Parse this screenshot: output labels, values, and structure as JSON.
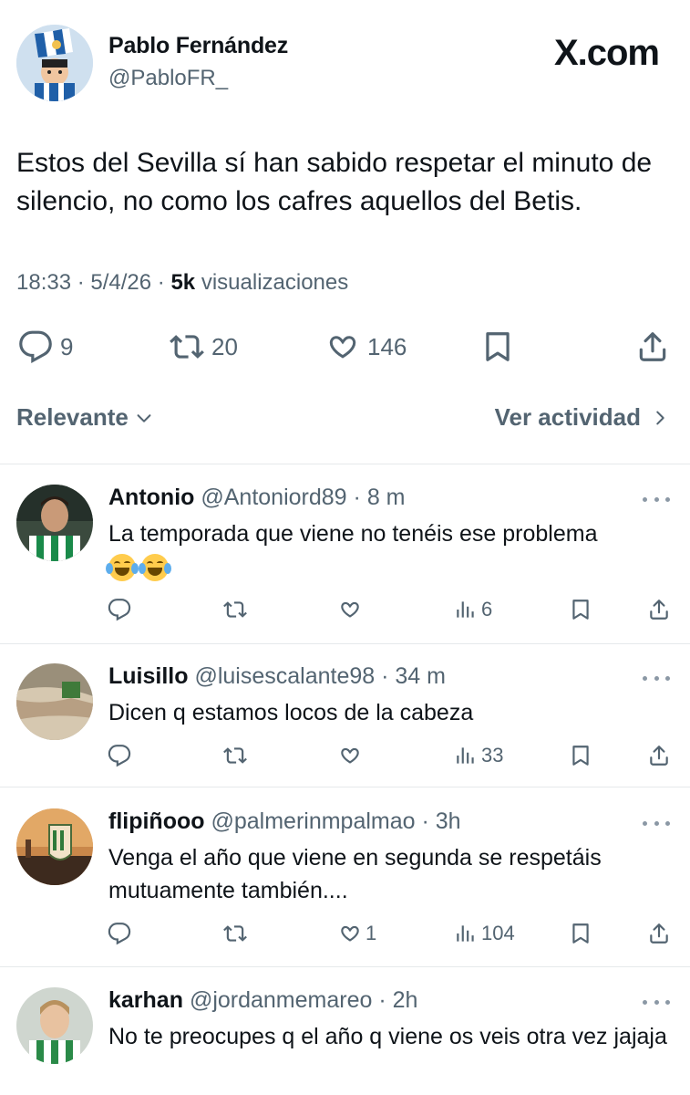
{
  "post": {
    "author_name": "Pablo Fernández",
    "author_handle": "@PabloFR_",
    "brand": "X.com",
    "text": "Estos del Sevilla sí han sabido respetar el minuto de silencio, no como los cafres aquellos del Betis.",
    "time": "18:33",
    "date": "5/4/26",
    "views_count": "5k",
    "views_label": "visualizaciones",
    "separator": " · ",
    "replies": "9",
    "reposts": "20",
    "likes": "146"
  },
  "sort": {
    "left_label": "Relevante",
    "right_label": "Ver actividad"
  },
  "replies": [
    {
      "name": "Antonio",
      "handle": "@Antoniord89",
      "time": "8 m",
      "text": "La temporada que viene no tenéis ese problema",
      "emoji": "😂😂",
      "likes": "",
      "views": "6"
    },
    {
      "name": "Luisillo",
      "handle": "@luisescalante98",
      "time": "34 m",
      "text": "Dicen q estamos locos de la cabeza",
      "likes": "",
      "views": "33"
    },
    {
      "name": "flipiñooo",
      "handle": "@palmerinmpalmao",
      "time": "3h",
      "text": "Venga el año que viene en segunda se respetáis mutuamente también....",
      "likes": "1",
      "views": "104"
    },
    {
      "name": "karhan",
      "handle": "@jordanmemareo",
      "time": "2h",
      "text": "No te preocupes q el año q viene os veis otra vez jajaja",
      "likes": "",
      "views": ""
    }
  ],
  "icons": {
    "reply": "reply-icon",
    "repost": "repost-icon",
    "like": "heart-icon",
    "bookmark": "bookmark-icon",
    "share": "share-icon",
    "views": "views-icon",
    "more": "more-icon",
    "chevron_down": "chevron-down-icon",
    "chevron_right": "chevron-right-icon"
  },
  "colors": {
    "text": "#0f1419",
    "secondary": "#536471",
    "divider": "#e6e9eb"
  }
}
